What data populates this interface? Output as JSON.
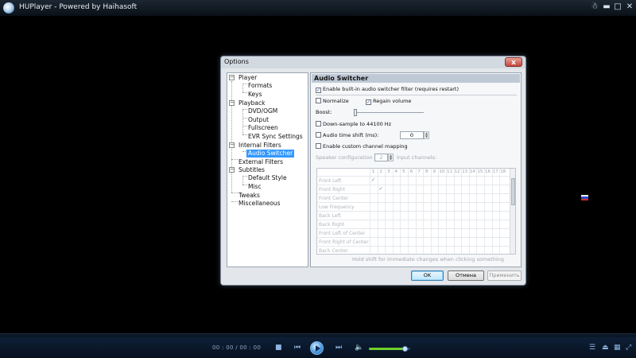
{
  "window": {
    "title": "HUPlayer - Powered by Haihasoft",
    "title_controls": [
      "tray",
      "minimize",
      "maximize",
      "close"
    ]
  },
  "dialog": {
    "title": "Options",
    "close_glyph": "x",
    "tree": {
      "items": [
        {
          "label": "Player",
          "level": 0,
          "expanded": true
        },
        {
          "label": "Formats",
          "level": 1
        },
        {
          "label": "Keys",
          "level": 1
        },
        {
          "label": "Playback",
          "level": 0,
          "expanded": true
        },
        {
          "label": "DVD/OGM",
          "level": 1
        },
        {
          "label": "Output",
          "level": 1
        },
        {
          "label": "Fullscreen",
          "level": 1
        },
        {
          "label": "EVR Sync Settings",
          "level": 1
        },
        {
          "label": "Internal Filters",
          "level": 0,
          "expanded": true
        },
        {
          "label": "Audio Switcher",
          "level": 1,
          "selected": true
        },
        {
          "label": "External Filters",
          "level": 0
        },
        {
          "label": "Subtitles",
          "level": 0,
          "expanded": true
        },
        {
          "label": "Default Style",
          "level": 1
        },
        {
          "label": "Misc",
          "level": 1
        },
        {
          "label": "Tweaks",
          "level": 0
        },
        {
          "label": "Miscellaneous",
          "level": 0
        }
      ]
    },
    "panel": {
      "header": "Audio Switcher",
      "enable_filter": {
        "label": "Enable built-in audio switcher filter (requires restart)",
        "checked": true
      },
      "normalize": {
        "label": "Normalize",
        "checked": false
      },
      "regain_volume": {
        "label": "Regain volume",
        "checked": true
      },
      "boost_label": "Boost:",
      "boost_level": 0,
      "downsample": {
        "label": "Down-sample to 44100 Hz",
        "checked": false
      },
      "time_shift": {
        "label": "Audio time shift (ms):",
        "checked": false,
        "value": "0"
      },
      "custom_mapping": {
        "label": "Enable custom channel mapping",
        "checked": false
      },
      "speaker_config": {
        "label_before": "Speaker configuration for",
        "value": "2",
        "label_after": "input channels:"
      },
      "matrix": {
        "columns": [
          "1",
          "2",
          "3",
          "4",
          "5",
          "6",
          "7",
          "8",
          "9",
          "10",
          "11",
          "12",
          "13",
          "14",
          "15",
          "16",
          "17",
          "18"
        ],
        "rows": [
          "Front Left",
          "Front Right",
          "Front Center",
          "Low Frequency",
          "Back Left",
          "Back Right",
          "Front Left of Center",
          "Front Right of Center",
          "Back Center"
        ],
        "checks": [
          [
            0,
            0
          ],
          [
            1,
            1
          ]
        ]
      },
      "hint": "Hold shift for immediate changes when clicking something"
    },
    "buttons": {
      "ok": "OK",
      "cancel": "Отмена",
      "apply": "Применить"
    }
  },
  "controls": {
    "time": "00 : 00 / 00 : 00",
    "volume_fraction": 0.88,
    "icons": [
      "stop-icon",
      "previous-icon",
      "play-icon",
      "next-icon",
      "volume-icon",
      "playlist-icon",
      "eject-icon",
      "fullscreen-icon"
    ]
  },
  "colors": {
    "accent": "#3399ff",
    "volume": "#6fcf2a",
    "flag": [
      "#ffffff",
      "#2a4bd0",
      "#d42a2a"
    ]
  }
}
